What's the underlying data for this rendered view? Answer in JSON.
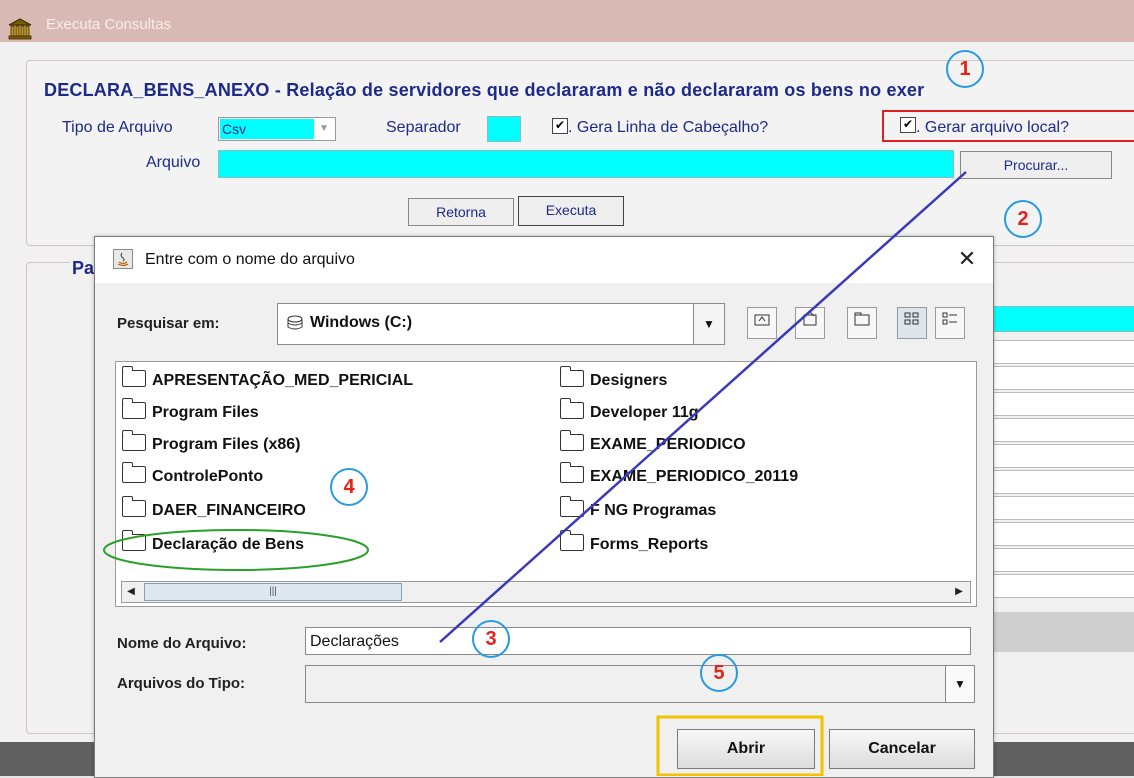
{
  "window": {
    "title": "Executa Consultas"
  },
  "form": {
    "heading": "DECLARA_BENS_ANEXO - Relação de servidores que declararam e não declararam os bens no exer",
    "tipo_label": "Tipo de Arquivo",
    "tipo_value": "Csv",
    "separador_label": "Separador",
    "gera_cabecalho_label": ". Gera Linha de Cabeçalho?",
    "gerar_local_label": ". Gerar arquivo local?",
    "arquivo_label": "Arquivo",
    "procurar_label": "Procurar...",
    "retorna_label": "Retorna",
    "executa_label": "Executa",
    "frame2_label": "Pa"
  },
  "dialog": {
    "title": "Entre com o nome do arquivo",
    "close": "✕",
    "look_in_label": "Pesquisar em:",
    "look_in_value": "Windows (C:)",
    "folders_col1": [
      "APRESENTAÇÃO_MED_PERICIAL",
      "Program Files",
      "Program Files (x86)",
      "ControlePonto",
      "DAER_FINANCEIRO",
      "Declaração de Bens"
    ],
    "folders_col2": [
      "Designers",
      "Developer 11g",
      "EXAME_PERIODICO",
      "EXAME_PERIODICO_20119",
      "F NG Programas",
      "Forms_Reports"
    ],
    "filename_label": "Nome do Arquivo:",
    "filename_value": "Declarações",
    "filetype_label": "Arquivos do Tipo:",
    "open_label": "Abrir",
    "cancel_label": "Cancelar"
  },
  "annotations": [
    "1",
    "2",
    "3",
    "4",
    "5"
  ],
  "colors": {
    "form_text": "#1d2a8a",
    "field_cyan": "#00ffff",
    "annotation_circle": "#2a9be0",
    "annotation_number": "#e2231a",
    "red_box": "#e02020",
    "green_oval": "#2aa02a",
    "yellow_box": "#f2c200",
    "arrow_line": "#3a3ab8"
  },
  "icons": [
    "app-icon",
    "java-icon",
    "disk-icon",
    "up-folder-icon",
    "home-icon",
    "new-folder-icon",
    "list-view-icon",
    "details-view-icon",
    "folder-icon"
  ]
}
